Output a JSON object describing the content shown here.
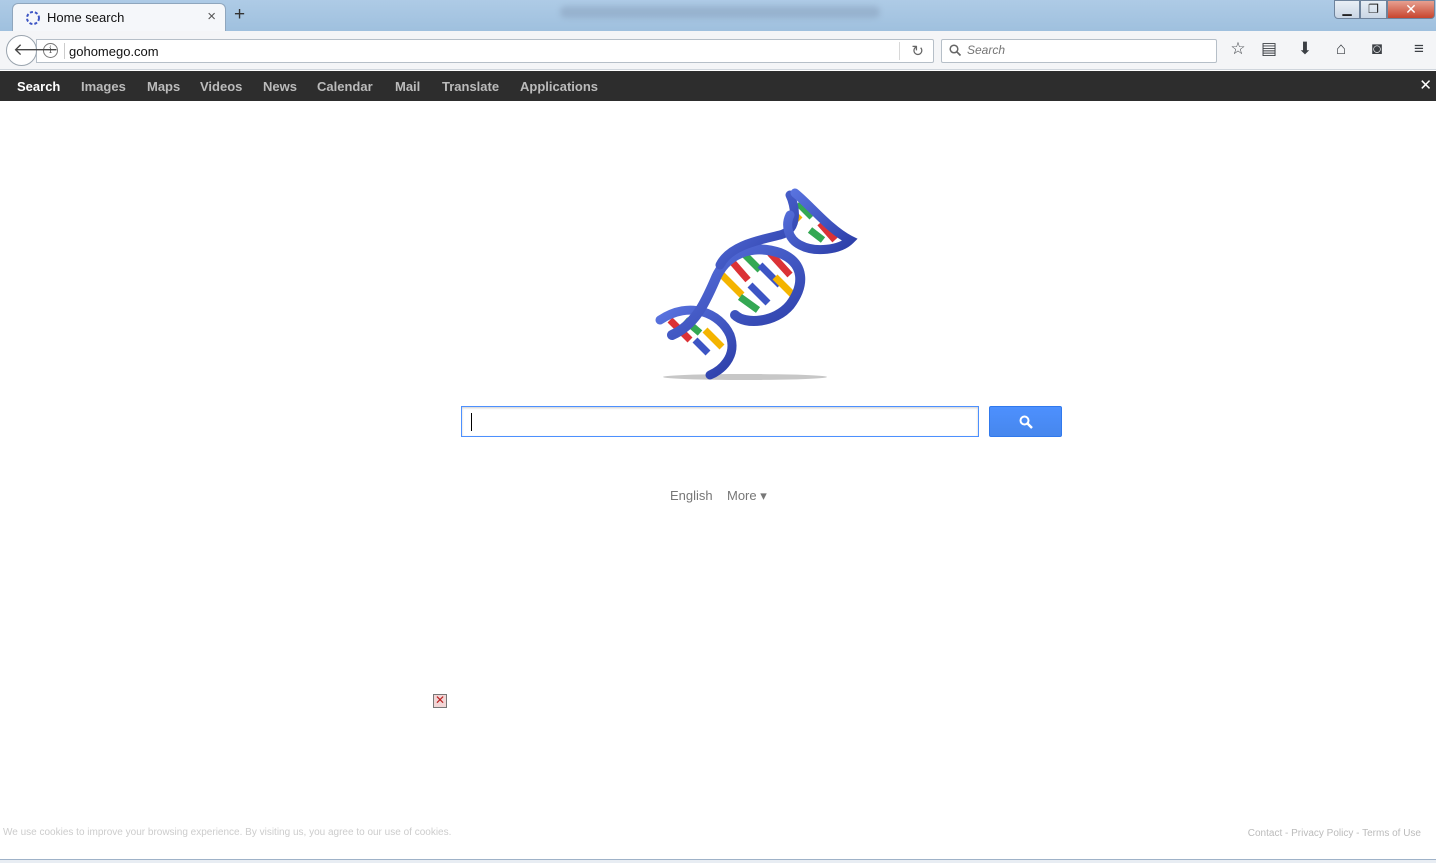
{
  "browser": {
    "tab_title": "Home search",
    "tab_close": "×",
    "new_tab": "+",
    "url": "gohomego.com",
    "search_placeholder": "Search",
    "window_controls": {
      "minimize": "▁",
      "maximize": "❐",
      "close": "✕"
    }
  },
  "site_nav": {
    "items": [
      {
        "label": "Search",
        "active": true
      },
      {
        "label": "Images"
      },
      {
        "label": "Maps"
      },
      {
        "label": "Videos"
      },
      {
        "label": "News"
      },
      {
        "label": "Calendar"
      },
      {
        "label": "Mail"
      },
      {
        "label": "Translate"
      },
      {
        "label": "Applications"
      }
    ],
    "close": "✕"
  },
  "main": {
    "search_value": "",
    "language": "English",
    "more": "More ▾"
  },
  "footer": {
    "cookie_notice": "We use cookies to improve your browsing experience. By visiting us, you agree to our use of cookies.",
    "contact": "Contact",
    "privacy": "Privacy Policy",
    "terms": "Terms of Use",
    "sep": " - "
  },
  "colors": {
    "accent": "#4d90fe",
    "nav_bg": "#2d2d2d",
    "helix_blue": "#3d55c4"
  }
}
